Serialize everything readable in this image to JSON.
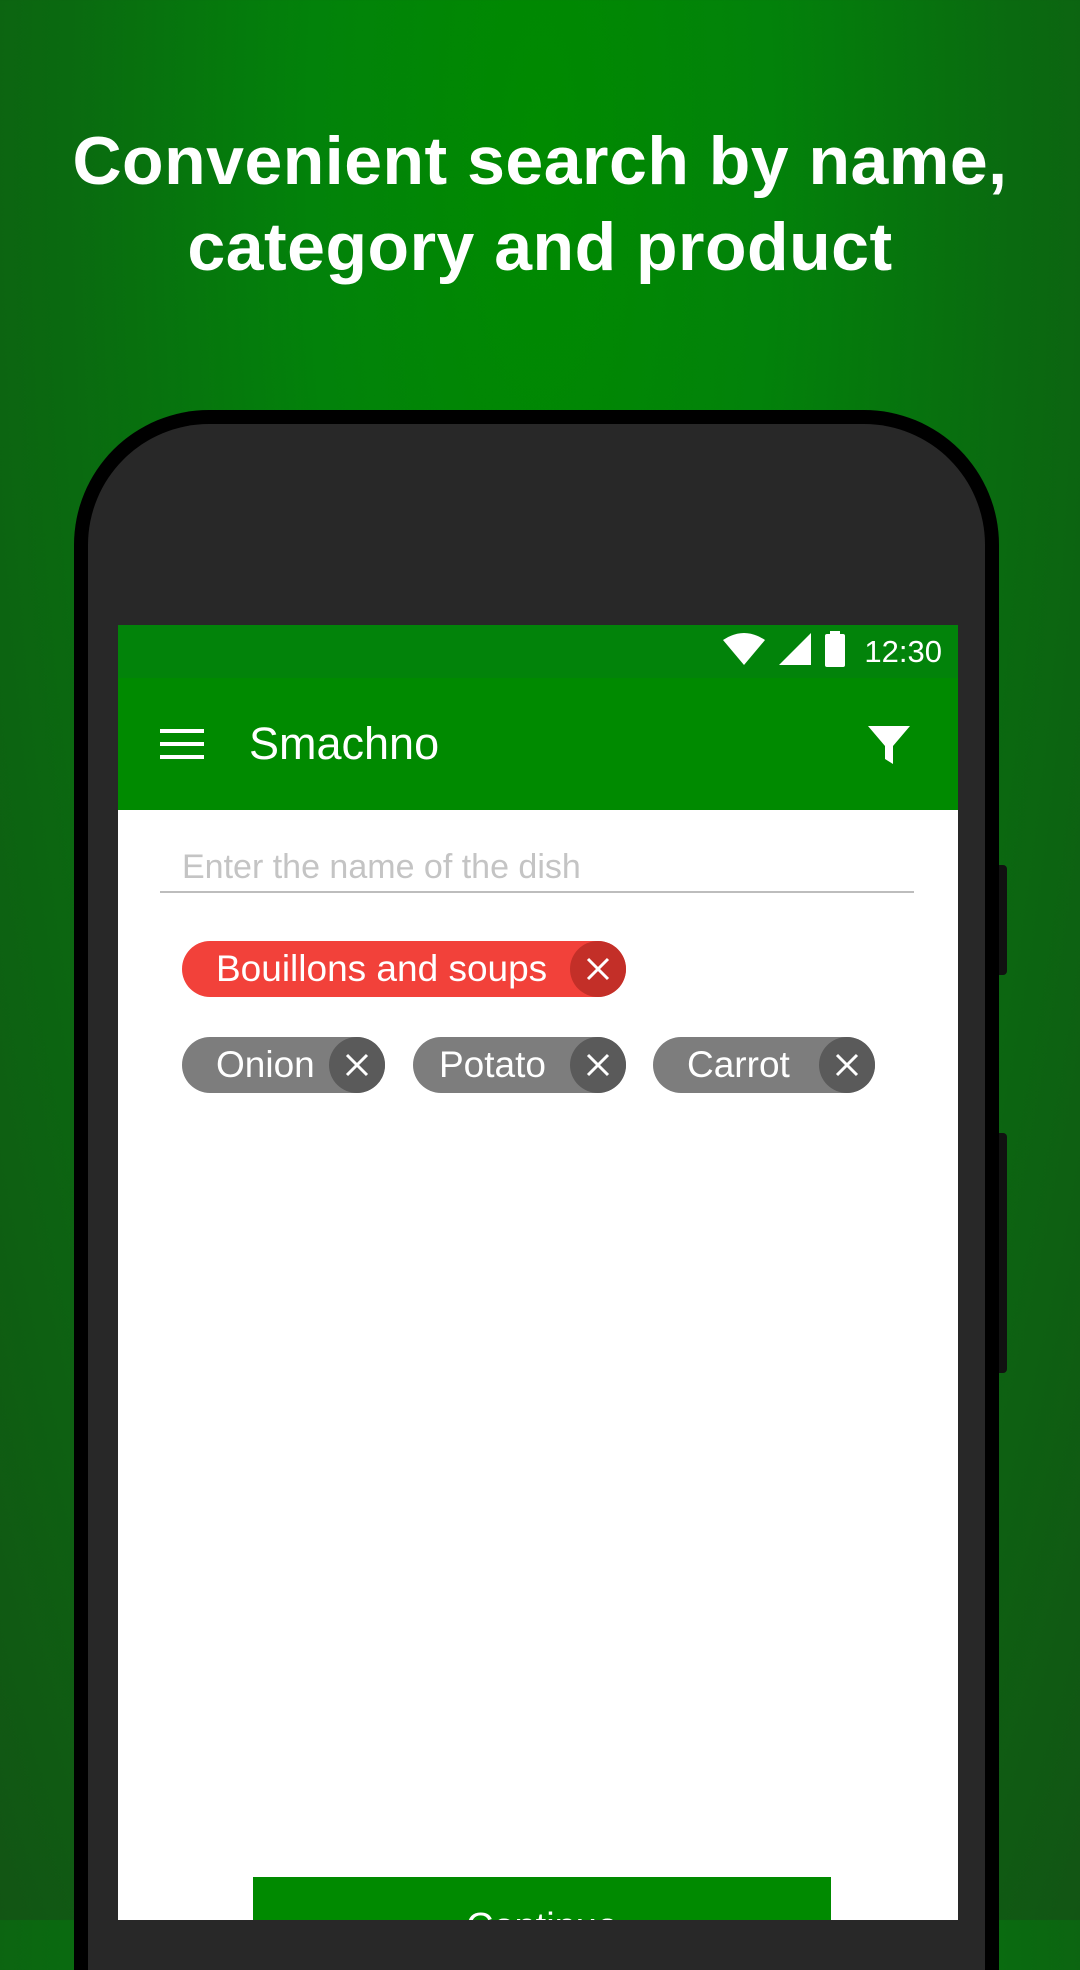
{
  "promo": {
    "headline_line1": "Convenient search by name,",
    "headline_line2": "category and product"
  },
  "status_bar": {
    "time": "12:30",
    "icons": [
      "wifi-icon",
      "signal-icon",
      "battery-icon"
    ]
  },
  "app_bar": {
    "title": "Smachno",
    "menu_icon": "menu-icon",
    "filter_icon": "filter-icon"
  },
  "search": {
    "placeholder": "Enter the name of the dish",
    "value": ""
  },
  "category_chip": {
    "label": "Bouillons and soups",
    "color": "#f2413a"
  },
  "product_chips": [
    {
      "label": "Onion"
    },
    {
      "label": "Potato"
    },
    {
      "label": "Carrot"
    }
  ],
  "continue_button": {
    "label": "Continue"
  },
  "colors": {
    "primary_green": "#008a00",
    "status_green": "#02830a",
    "category_red": "#f2413a",
    "chip_gray": "#7d7d7d"
  }
}
